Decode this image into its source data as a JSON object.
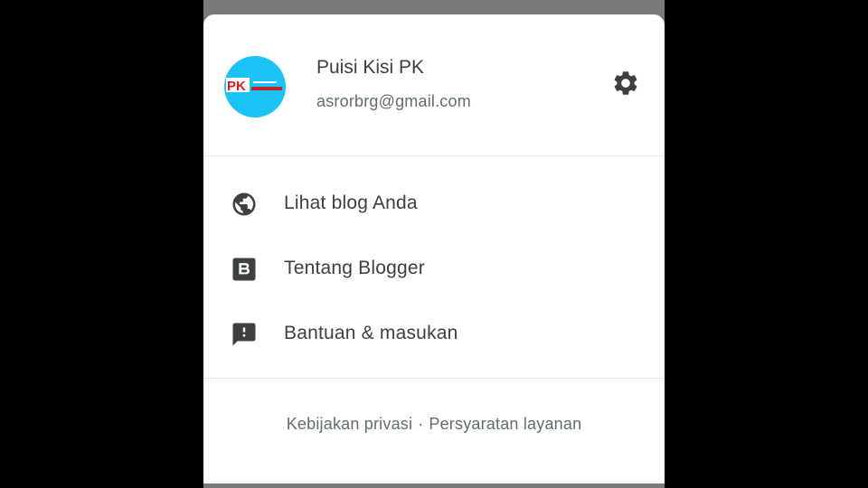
{
  "account": {
    "name": "Puisi Kisi PK",
    "email": "asrorbrg@gmail.com",
    "avatar_logo_text": "PK",
    "avatar_color": "#1ec3f5"
  },
  "settings": {
    "icon": "gear-icon"
  },
  "menu": {
    "items": [
      {
        "label": "Lihat blog Anda",
        "icon": "globe-icon"
      },
      {
        "label": "Tentang Blogger",
        "icon": "blogger-icon"
      },
      {
        "label": "Bantuan & masukan",
        "icon": "feedback-icon"
      }
    ]
  },
  "footer": {
    "privacy": "Kebijakan privasi",
    "separator": "·",
    "terms": "Persyaratan layanan"
  },
  "colors": {
    "text_primary": "#3c4043",
    "text_secondary": "#5f6e73",
    "icon": "#3c4043",
    "background": "#ffffff"
  }
}
